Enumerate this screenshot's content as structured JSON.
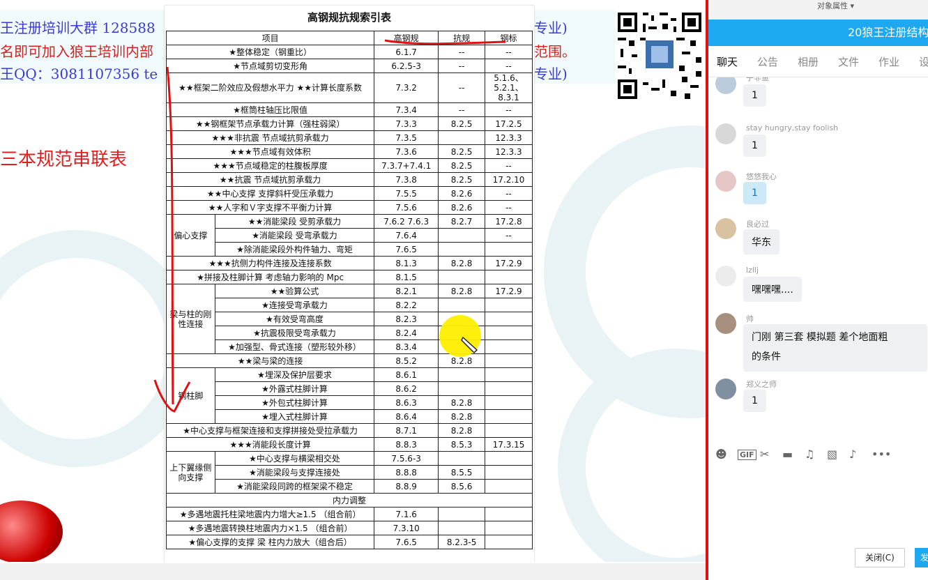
{
  "banner": {
    "line1": "王注册培训大群 128588",
    "line1_tail": "专业)",
    "line2": "名即可加入狼王培训内部",
    "line2_tail": "范围。",
    "line3": "王QQ：3081107356    te",
    "line3_tail": "专业)"
  },
  "slide_title": "三本规范串联表",
  "table": {
    "title": "高钢规抗规索引表",
    "header": [
      "项目",
      "高钢规",
      "抗规",
      "钢标"
    ],
    "rows": [
      {
        "item": "★整体稳定（钢重比）",
        "a": "6.1.7",
        "b": "--",
        "c": "--"
      },
      {
        "item": "★节点域剪切变形角",
        "a": "6.2.5-3",
        "b": "--",
        "c": "--"
      },
      {
        "item": "★★框架二阶效应及假想水平力 ★★计算长度系数",
        "a": "7.3.2",
        "b": "--",
        "c": "5.1.6、5.2.1、8.3.1"
      },
      {
        "item": "★框筒柱轴压比限值",
        "a": "7.3.4",
        "b": "--",
        "c": "--"
      },
      {
        "item": "★★钢框架节点承载力计算（强柱弱梁）",
        "a": "7.3.3",
        "b": "8.2.5",
        "c": "17.2.5"
      },
      {
        "item": "★★★非抗震  节点域抗剪承载力",
        "a": "7.3.5",
        "b": "",
        "c": "12.3.3"
      },
      {
        "item": "★★★节点域有效体积",
        "a": "7.3.6",
        "b": "8.2.5",
        "c": "12.3.3"
      },
      {
        "item": "★★★节点域稳定的柱腹板厚度",
        "a": "7.3.7+7.4.1",
        "b": "8.2.5",
        "c": "--"
      },
      {
        "item": "★★抗震  节点域抗剪承载力",
        "a": "7.3.8",
        "b": "8.2.5",
        "c": "17.2.10"
      },
      {
        "item": "★★中心支撑  支撑斜杆受压承载力",
        "a": "7.5.5",
        "b": "8.2.6",
        "c": "--"
      },
      {
        "item": "★★人字和Ｖ字支撑不平衡力计算",
        "a": "7.5.6",
        "b": "8.2.6",
        "c": "--"
      }
    ],
    "group1": {
      "label": "偏心支撑",
      "rows": [
        {
          "item": "★★消能梁段 受剪承载力",
          "a": "7.6.2  7.6.3",
          "b": "8.2.7",
          "c": "17.2.8"
        },
        {
          "item": "★消能梁段 受弯承载力",
          "a": "7.6.4",
          "b": "",
          "c": "--"
        },
        {
          "item": "★除消能梁段外构件轴力、弯矩",
          "a": "7.6.5",
          "b": "",
          "c": ""
        }
      ]
    },
    "rows2": [
      {
        "item": "★★★抗侧力构件连接及连接系数",
        "a": "8.1.3",
        "b": "8.2.8",
        "c": "17.2.9"
      },
      {
        "item": "★拼接及柱脚计算 考虑轴力影响的 Mpc",
        "a": "8.1.5",
        "b": "",
        "c": ""
      }
    ],
    "group2": {
      "label": "梁与柱的刚性连接",
      "rows": [
        {
          "item": "★★验算公式",
          "a": "8.2.1",
          "b": "8.2.8",
          "c": "17.2.9"
        },
        {
          "item": "★连接受弯承载力",
          "a": "8.2.2",
          "b": "",
          "c": ""
        },
        {
          "item": "★有效受弯高度",
          "a": "8.2.3",
          "b": "",
          "c": ""
        },
        {
          "item": "★抗震极限受弯承载力",
          "a": "8.2.4",
          "b": "",
          "c": ""
        },
        {
          "item": "★加强型、骨式连接（塑形较外移）",
          "a": "8.3.4",
          "b": "",
          "c": ""
        }
      ]
    },
    "rows3": [
      {
        "item": "★★梁与梁的连接",
        "a": "8.5.2",
        "b": "8.2.8",
        "c": ""
      }
    ],
    "group3": {
      "label": "钢柱脚",
      "rows": [
        {
          "item": "★埋深及保护层要求",
          "a": "8.6.1",
          "b": "",
          "c": ""
        },
        {
          "item": "★外露式柱脚计算",
          "a": "8.6.2",
          "b": "",
          "c": ""
        },
        {
          "item": "★外包式柱脚计算",
          "a": "8.6.3",
          "b": "8.2.8",
          "c": ""
        },
        {
          "item": "★埋入式柱脚计算",
          "a": "8.6.4",
          "b": "8.2.8",
          "c": ""
        }
      ]
    },
    "rows4": [
      {
        "item": "★中心支撑与框架连接和支撑拼接处受拉承载力",
        "a": "8.7.1",
        "b": "8.2.8",
        "c": ""
      },
      {
        "item": "★★★消能段长度计算",
        "a": "8.8.3",
        "b": "8.5.3",
        "c": "17.3.15"
      }
    ],
    "group4": {
      "label": "上下翼缘侧向支撑",
      "rows": [
        {
          "item": "★中心支撑与横梁相交处",
          "a": "7.5.6-3",
          "b": "",
          "c": ""
        },
        {
          "item": "★消能梁段与支撑连接处",
          "a": "8.8.8",
          "b": "8.5.5",
          "c": ""
        },
        {
          "item": "★消能梁段同跨的框架梁不稳定",
          "a": "8.8.9",
          "b": "8.5.6",
          "c": ""
        }
      ]
    },
    "section_label": "内力调整",
    "rows5": [
      {
        "item": "★多遇地震托柱梁地震内力增大≥1.5 （组合前）",
        "a": "7.1.6",
        "b": "",
        "c": ""
      },
      {
        "item": "★多遇地震转换柱地震内力×1.5 （组合前）",
        "a": "7.3.10",
        "b": "",
        "c": ""
      },
      {
        "item": "★偏心支撑的支撑 梁 柱内力放大（组合后）",
        "a": "7.6.5",
        "b": "8.2.3-5",
        "c": ""
      }
    ]
  },
  "top_strip": {
    "label": "对象属性 ▾"
  },
  "chat": {
    "title": "20狼王注册结构",
    "tabs": [
      "聊天",
      "公告",
      "相册",
      "文件",
      "作业",
      "设"
    ],
    "messages": [
      {
        "user": "子非鱼",
        "text": "1"
      },
      {
        "user": "stay hungry,stay foolish",
        "text": "1"
      },
      {
        "user": "悠悠我心",
        "text": "1"
      },
      {
        "user": "良必过",
        "text": "华东"
      },
      {
        "user": "lzllj",
        "text": "嘿嘿嘿...."
      },
      {
        "user": "帅",
        "text": "门刚   第三套 模拟题     差个地面粗",
        "text2": "的条件"
      },
      {
        "user": "郑义之师",
        "text": "1"
      }
    ],
    "toolbar_icons": [
      "smile-icon",
      "gif-icon",
      "scissors-icon",
      "folder-icon",
      "music-icon",
      "image-icon",
      "bell-icon",
      "more-icon"
    ],
    "close_label": "关闭(C)",
    "send_label": "发"
  },
  "colors": {
    "accent": "#1ea8f0",
    "annotation_red": "#e01010",
    "highlight_yellow": "#ffee00"
  }
}
